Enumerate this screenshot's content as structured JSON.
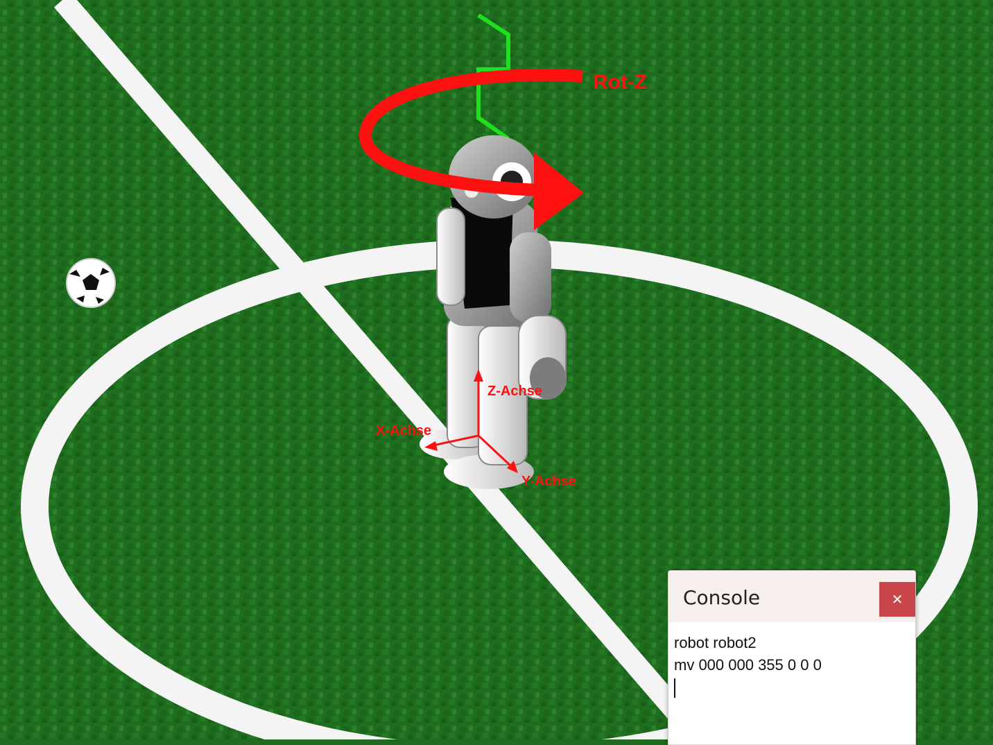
{
  "annotations": {
    "rot_z": "Rot-Z",
    "z_axis": "Z-Achse",
    "x_axis": "X-Achse",
    "y_axis": "Y-Achse"
  },
  "console": {
    "title": "Console",
    "close_icon": "close-icon",
    "lines": [
      "robot robot2",
      "mv 000 000 355 0 0 0"
    ]
  },
  "colors": {
    "field": "#1f6b1f",
    "annotation": "#ff1010",
    "close_button": "#c9474a"
  }
}
